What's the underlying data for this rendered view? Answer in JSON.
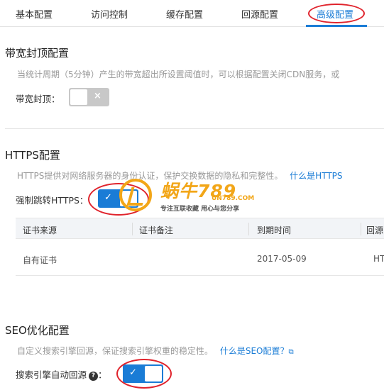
{
  "tabs": [
    {
      "label": "基本配置"
    },
    {
      "label": "访问控制"
    },
    {
      "label": "缓存配置"
    },
    {
      "label": "回源配置"
    },
    {
      "label": "高级配置",
      "active": true
    }
  ],
  "bandwidth": {
    "title": "带宽封顶配置",
    "description": "当统计周期（5分钟）产生的带宽超出所设置阈值时，可以根据配置关闭CDN服务，或",
    "toggle_label": "带宽封顶：",
    "toggle_state": "off",
    "toggle_icon": "×"
  },
  "https": {
    "title": "HTTPS配置",
    "description": "HTTPS提供对网络服务器的身份认证，保护交换数据的隐私和完整性。",
    "help_link": "什么是HTTPS",
    "toggle_label": "强制跳转HTTPS：",
    "toggle_state": "on",
    "toggle_icon": "✓",
    "table": {
      "headers": [
        "证书来源",
        "证书备注",
        "到期时间",
        "回源"
      ],
      "rows": [
        {
          "source": "自有证书",
          "note": "",
          "expires": "2017-05-09",
          "origin": "HT"
        }
      ]
    }
  },
  "seo": {
    "title": "SEO优化配置",
    "description": "自定义搜索引擎回源，保证搜索引擎权重的稳定性。",
    "help_link": "什么是SEO配置？",
    "toggle_label": "搜索引擎自动回源",
    "help_icon": "?",
    "colon": "：",
    "toggle_state": "on",
    "toggle_icon": "✓"
  },
  "watermark": {
    "brand": "蜗牛789",
    "site": "UN789.COM",
    "slogan": "专注互联收藏  用心与您分享"
  },
  "colors": {
    "accent": "#1a7cd6",
    "annotation": "#e0232c",
    "watermark": "#f2a618"
  }
}
